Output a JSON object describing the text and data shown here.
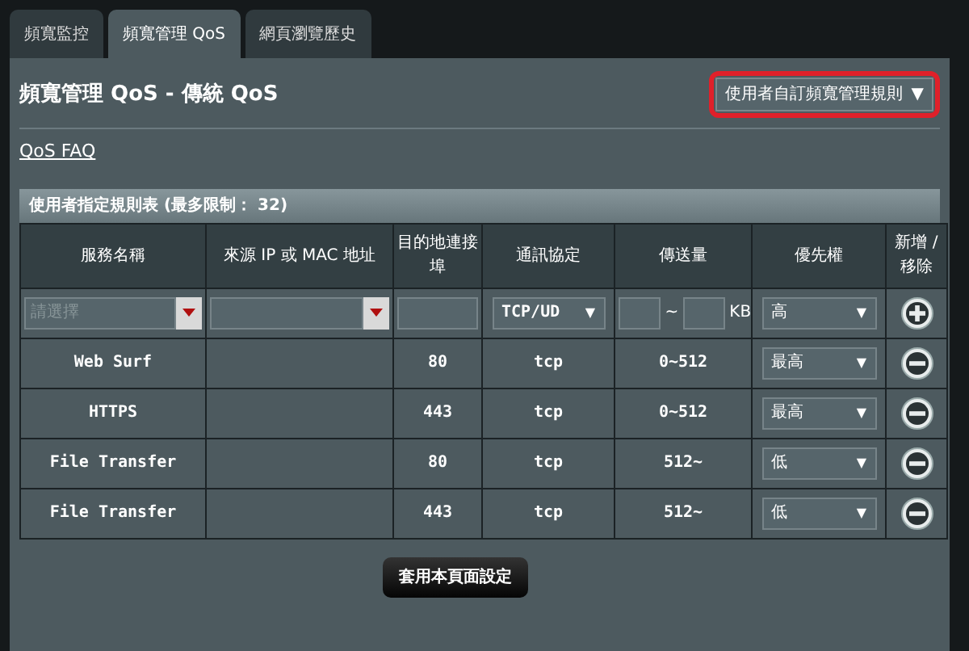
{
  "tabs": [
    {
      "label": "頻寬監控",
      "selected": false
    },
    {
      "label": "頻寬管理 QoS",
      "selected": true
    },
    {
      "label": "網頁瀏覽歷史",
      "selected": false
    }
  ],
  "title": "頻寬管理 QoS - 傳統 QoS",
  "mode_dropdown": {
    "value": "使用者自訂頻寬管理規則",
    "caret": "▼",
    "highlighted": true
  },
  "faq_link": "QoS FAQ",
  "table": {
    "caption": "使用者指定規則表 (最多限制： 32)",
    "columns": [
      "服務名稱",
      "來源 IP 或 MAC 地址",
      "目的地連接埠",
      "通訊協定",
      "傳送量",
      "優先權",
      "新增 / 移除"
    ],
    "input_row": {
      "service": {
        "placeholder": "請選擇"
      },
      "protocol": "TCP/UD",
      "protocol_caret": "▼",
      "range_sep": "~",
      "unit": "KB",
      "priority": "高",
      "priority_caret": "▼"
    },
    "rows": [
      {
        "service": "Web Surf",
        "port": "80",
        "protocol": "tcp",
        "amount": "0~512",
        "priority": "最高"
      },
      {
        "service": "HTTPS",
        "port": "443",
        "protocol": "tcp",
        "amount": "0~512",
        "priority": "最高"
      },
      {
        "service": "File Transfer",
        "port": "80",
        "protocol": "tcp",
        "amount": "512~",
        "priority": "低"
      },
      {
        "service": "File Transfer",
        "port": "443",
        "protocol": "tcp",
        "amount": "512~",
        "priority": "低"
      }
    ],
    "priority_caret": "▼"
  },
  "apply_button": "套用本頁面設定"
}
